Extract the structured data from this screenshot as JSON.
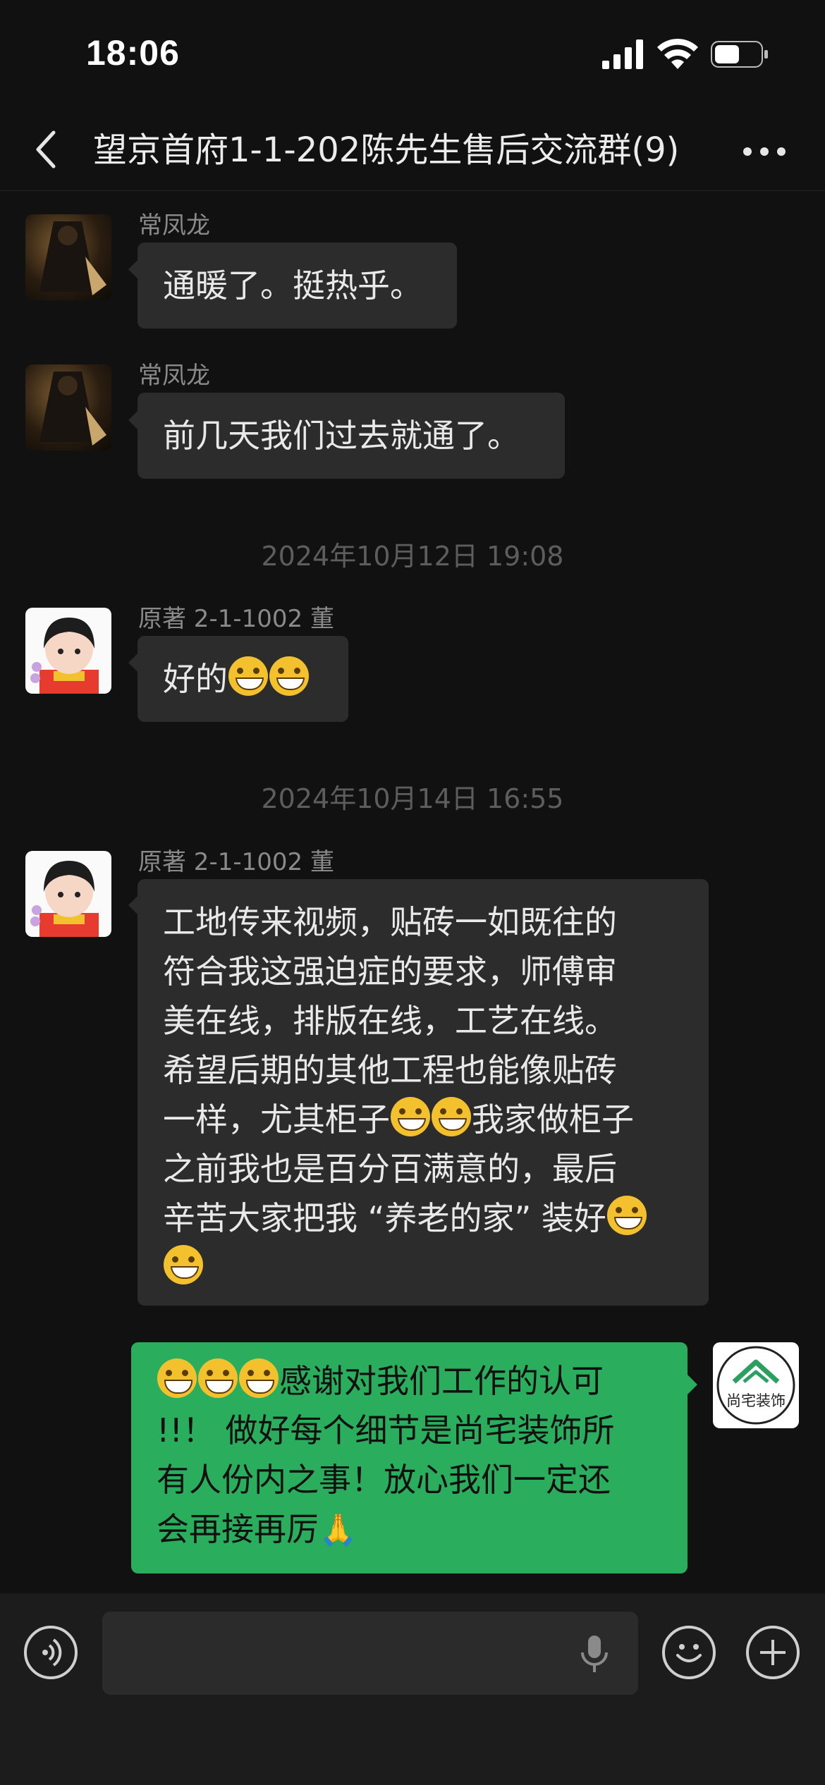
{
  "status_bar": {
    "time": "18:06"
  },
  "header": {
    "title": "望京首府1-1-202陈先生售后交流群(9)"
  },
  "messages": [
    {
      "sender": "常凤龙",
      "text": "通暖了。挺热乎。"
    },
    {
      "sender": "常凤龙",
      "text": "前几天我们过去就通了。"
    },
    {
      "timestamp": "2024年10月12日 19:08"
    },
    {
      "sender": "原著 2-1-1002 董",
      "text": "好的"
    },
    {
      "timestamp": "2024年10月14日 16:55"
    },
    {
      "sender": "原著 2-1-1002 董",
      "lines": [
        "工地传来视频，贴砖一如既往的",
        "符合我这强迫症的要求，师傅审",
        "美在线，排版在线，工艺在线。",
        "希望后期的其他工程也能像贴砖",
        "一样，尤其柜子",
        "我家做柜子",
        "之前我也是百分百满意的，最后",
        "辛苦大家把我 “养老的家” 装好"
      ]
    },
    {
      "self": true,
      "lines": [
        "感谢对我们工作的认可",
        "!!！ 做好每个细节是尚宅装饰所",
        "有人份内之事！放心我们一定还",
        "会再接再厉"
      ],
      "avatar_text": "尚宅装饰"
    }
  ],
  "icons": {
    "back": "back-chevron-icon",
    "more": "more-dots-icon",
    "voice": "voice-icon",
    "mic": "microphone-icon",
    "emoji": "emoji-icon",
    "plus": "plus-icon"
  },
  "colors": {
    "background": "#111111",
    "bubble_other": "#2c2c2c",
    "bubble_self": "#2aae5e"
  }
}
